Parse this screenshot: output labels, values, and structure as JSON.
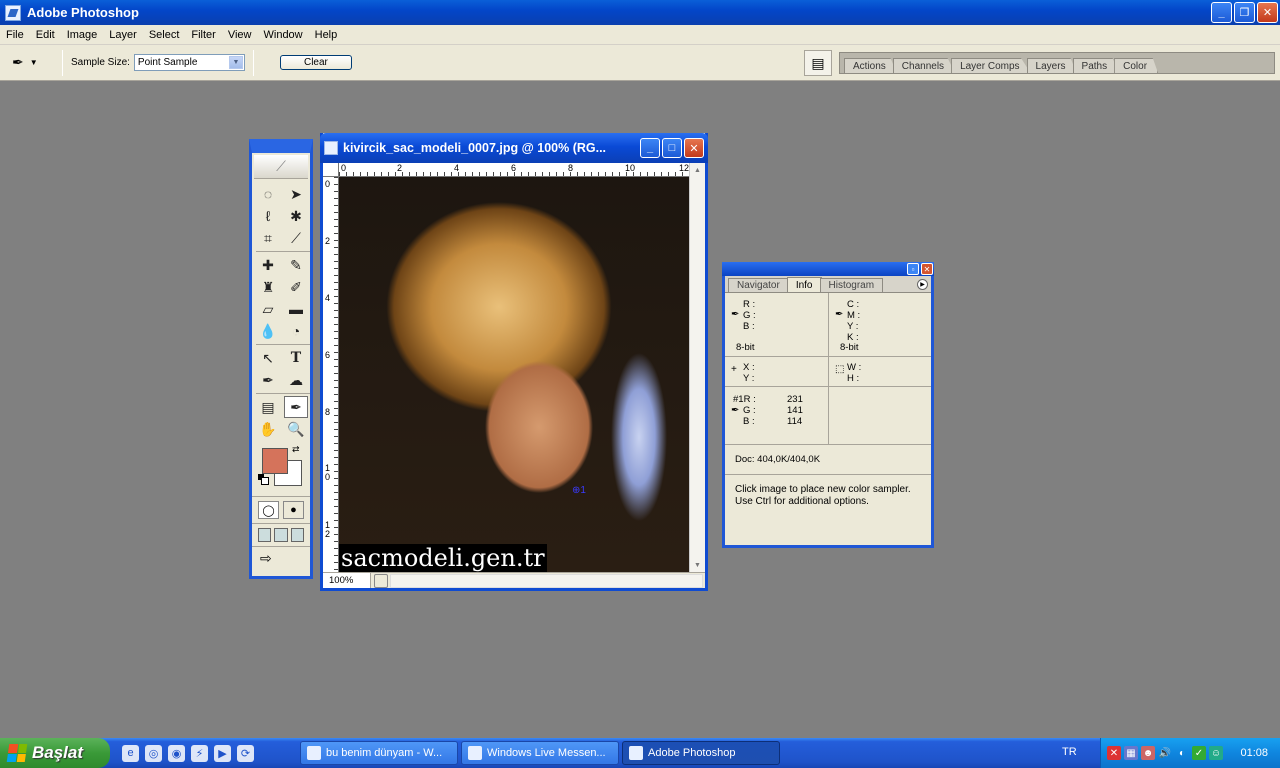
{
  "app": {
    "title": "Adobe Photoshop"
  },
  "menu": [
    "File",
    "Edit",
    "Image",
    "Layer",
    "Select",
    "Filter",
    "View",
    "Window",
    "Help"
  ],
  "options": {
    "sample_size_label": "Sample Size:",
    "sample_size_value": "Point Sample",
    "clear_label": "Clear"
  },
  "dock_tabs": [
    "Actions",
    "Channels",
    "Layer Comps",
    "Layers",
    "Paths",
    "Color"
  ],
  "document": {
    "title": "kivircik_sac_modeli_0007.jpg @ 100% (RG...",
    "zoom": "100%",
    "watermark": "sacmodeli.gen.tr",
    "sampler_label": "1",
    "hruler_labels": [
      "0",
      "2",
      "4",
      "6",
      "8",
      "10",
      "12"
    ],
    "vruler_labels": [
      "0",
      "2",
      "4",
      "6",
      "8",
      "10",
      "12"
    ]
  },
  "colors": {
    "foreground": "#d5735b",
    "background": "#ffffff"
  },
  "info": {
    "tabs": [
      "Navigator",
      "Info",
      "Histogram"
    ],
    "active_tab": "Info",
    "rgb": {
      "r": "R :",
      "g": "G :",
      "b": "B :",
      "depth": "8-bit"
    },
    "cmyk": {
      "c": "C :",
      "m": "M :",
      "y": "Y :",
      "k": "K :",
      "depth": "8-bit"
    },
    "xy": {
      "x": "X :",
      "y": "Y :"
    },
    "wh": {
      "w": "W :",
      "h": "H :"
    },
    "sampler1": {
      "r_label": "#1R :",
      "r": "231",
      "g_label": "G :",
      "g": "141",
      "b_label": "B :",
      "b": "114"
    },
    "doc": "Doc: 404,0K/404,0K",
    "hint1": "Click image to place new color sampler.",
    "hint2": "Use Ctrl for additional options."
  },
  "taskbar": {
    "start": "Başlat",
    "tasks": [
      "bu benim dünyam - W...",
      "Windows Live Messen...",
      "Adobe Photoshop"
    ],
    "lang": "TR",
    "clock": "01:08"
  }
}
